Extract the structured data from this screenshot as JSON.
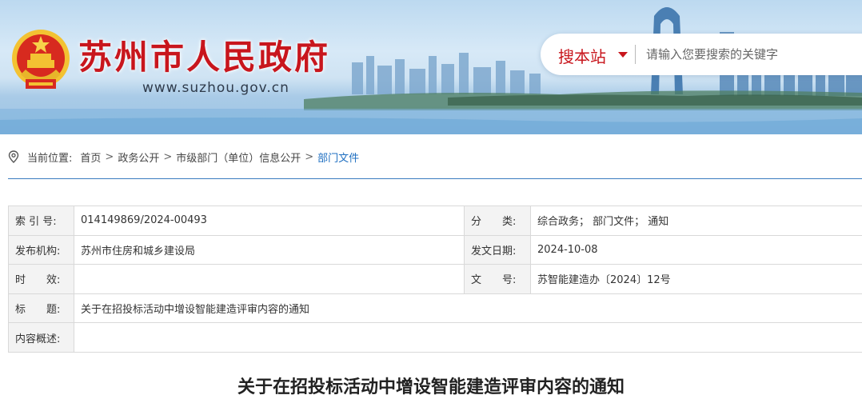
{
  "header": {
    "site_title": "苏州市人民政府",
    "site_url": "www.suzhou.gov.cn",
    "emblem_icon": "national-emblem-icon",
    "brand_color": "#c8161d"
  },
  "search": {
    "scope_label": "搜本站",
    "placeholder": "请输入您要搜索的关键字"
  },
  "breadcrumb": {
    "label": "当前位置:",
    "separator": ">",
    "items": [
      "首页",
      "政务公开",
      "市级部门（单位）信息公开",
      "部门文件"
    ],
    "current_color": "#1f6fc1"
  },
  "meta": {
    "index_no_label": "索 引 号:",
    "index_no": "014149869/2024-00493",
    "category_label": "分　　类:",
    "category": "综合政务；  部门文件；  通知",
    "publisher_label": "发布机构:",
    "publisher": "苏州市住房和城乡建设局",
    "issue_date_label": "发文日期:",
    "issue_date": "2024-10-08",
    "validity_label": "时　　效:",
    "validity": "",
    "doc_no_label": "文　　号:",
    "doc_no": "苏智能建造办〔2024〕12号",
    "title_label": "标　　题:",
    "title": "关于在招投标活动中增设智能建造评审内容的通知",
    "summary_label": "内容概述:",
    "summary": ""
  },
  "document": {
    "title": "关于在招投标活动中增设智能建造评审内容的通知"
  }
}
